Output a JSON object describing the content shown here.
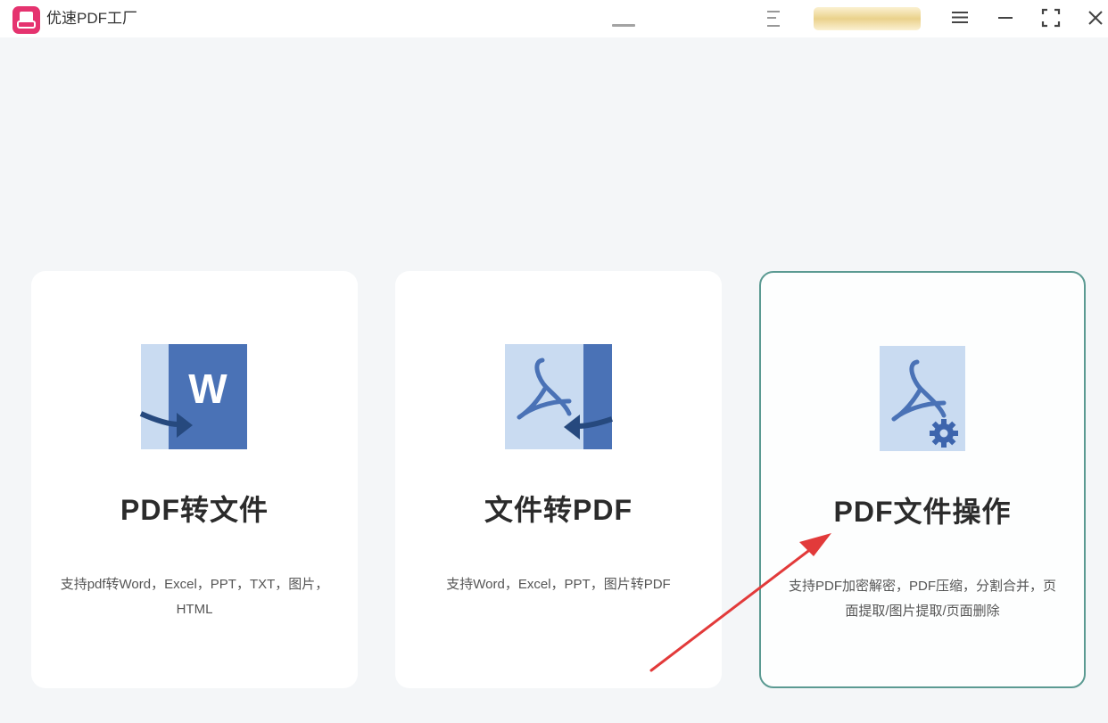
{
  "window": {
    "title": "优速PDF工厂",
    "icons": {
      "logo": "app-logo-icon",
      "menu": "menu-icon",
      "minimize": "minimize-icon",
      "maximize": "maximize-icon",
      "close": "close-icon"
    }
  },
  "cards": [
    {
      "title": "PDF转文件",
      "description": "支持pdf转Word，Excel，PPT，TXT，图片，HTML",
      "icon": "pdf-to-word-icon",
      "selected": false
    },
    {
      "title": "文件转PDF",
      "description": "支持Word，Excel，PPT，图片转PDF",
      "icon": "file-to-pdf-icon",
      "selected": false
    },
    {
      "title": "PDF文件操作",
      "description": "支持PDF加密解密，PDF压缩，分割合并，页面提取/图片提取/页面删除",
      "icon": "pdf-settings-icon",
      "selected": true
    }
  ],
  "colors": {
    "brand": "#e5336f",
    "icon_light": "#c9dbf1",
    "icon_dark": "#4a72b6",
    "selected_border": "#5b9a92",
    "annotation_arrow": "#e23a3a"
  }
}
